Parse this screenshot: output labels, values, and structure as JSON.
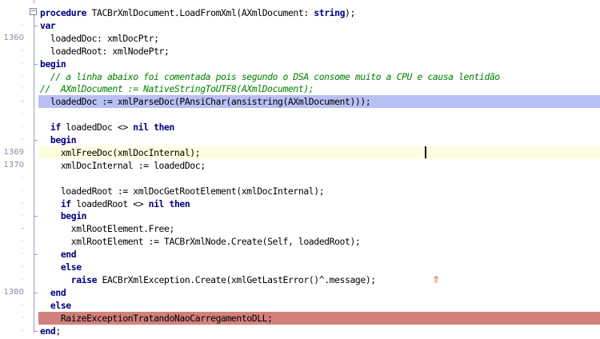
{
  "editor": {
    "lines": [
      {
        "num": "",
        "tokens": [
          {
            "t": "procedure",
            "c": "kw"
          },
          {
            "t": " TACBrXmlDocument.LoadFromXml(AXmlDocument: "
          },
          {
            "t": "string",
            "c": "kw"
          },
          {
            "t": ");"
          }
        ]
      },
      {
        "num": "·",
        "tokens": [
          {
            "t": "var",
            "c": "kw"
          }
        ]
      },
      {
        "num": "1360",
        "tokens": [
          {
            "t": "  loadedDoc: xmlDocPtr;"
          }
        ]
      },
      {
        "num": "·",
        "tokens": [
          {
            "t": "  loadedRoot: xmlNodePtr;"
          }
        ]
      },
      {
        "num": "·",
        "tokens": [
          {
            "t": "begin",
            "c": "kw"
          }
        ]
      },
      {
        "num": "·",
        "tokens": [
          {
            "t": "  // a linha abaixo foi comentada pois segundo o DSA consome muito a CPU e causa lentidão",
            "c": "cm"
          }
        ]
      },
      {
        "num": "·",
        "tokens": [
          {
            "t": "//  AXmlDocument := NativeStringToUTF8(AXmlDocument);",
            "c": "cm"
          }
        ]
      },
      {
        "num": "–",
        "tokens": [
          {
            "t": "  loadedDoc := xmlParseDoc(PAnsiChar(ansistring(AXmlDocument)));"
          }
        ],
        "highlight": "active"
      },
      {
        "num": "·",
        "tokens": [
          {
            "t": ""
          }
        ]
      },
      {
        "num": "·",
        "tokens": [
          {
            "t": "  "
          },
          {
            "t": "if",
            "c": "kw"
          },
          {
            "t": " loadedDoc <> "
          },
          {
            "t": "nil",
            "c": "kw"
          },
          {
            "t": " "
          },
          {
            "t": "then",
            "c": "kw"
          }
        ]
      },
      {
        "num": "·",
        "tokens": [
          {
            "t": "  "
          },
          {
            "t": "begin",
            "c": "kw"
          }
        ]
      },
      {
        "num": "1369",
        "tokens": [
          {
            "t": "    xmlFreeDoc(xmlDocInternal);"
          }
        ],
        "highlight": "cursor"
      },
      {
        "num": "1370",
        "tokens": [
          {
            "t": "    xmlDocInternal := loadedDoc;"
          }
        ]
      },
      {
        "num": "·",
        "tokens": [
          {
            "t": ""
          }
        ]
      },
      {
        "num": "·",
        "tokens": [
          {
            "t": "    loadedRoot := xmlDocGetRootElement(xmlDocInternal);"
          }
        ]
      },
      {
        "num": "·",
        "tokens": [
          {
            "t": "    "
          },
          {
            "t": "if",
            "c": "kw"
          },
          {
            "t": " loadedRoot <> "
          },
          {
            "t": "nil",
            "c": "kw"
          },
          {
            "t": " "
          },
          {
            "t": "then",
            "c": "kw"
          }
        ]
      },
      {
        "num": "·",
        "tokens": [
          {
            "t": "    "
          },
          {
            "t": "begin",
            "c": "kw"
          }
        ]
      },
      {
        "num": "–",
        "tokens": [
          {
            "t": "      xmlRootElement.Free;"
          }
        ]
      },
      {
        "num": "·",
        "tokens": [
          {
            "t": "      xmlRootElement := TACBrXmlNode.Create(Self, loadedRoot);"
          }
        ]
      },
      {
        "num": "·",
        "tokens": [
          {
            "t": "    "
          },
          {
            "t": "end",
            "c": "kw"
          }
        ]
      },
      {
        "num": "·",
        "tokens": [
          {
            "t": "    "
          },
          {
            "t": "else",
            "c": "kw"
          }
        ]
      },
      {
        "num": "·",
        "tokens": [
          {
            "t": "      "
          },
          {
            "t": "raise",
            "c": "kw"
          },
          {
            "t": " EACBrXmlException.Create(xmlGetLastError()^.message);"
          }
        ]
      },
      {
        "num": "1380",
        "tokens": [
          {
            "t": "  "
          },
          {
            "t": "end",
            "c": "kw"
          }
        ]
      },
      {
        "num": "·",
        "tokens": [
          {
            "t": "  "
          },
          {
            "t": "else",
            "c": "kw"
          }
        ]
      },
      {
        "num": "·",
        "tokens": [
          {
            "t": "    RaizeExceptionTratandoNaoCarregamentoDLL;"
          }
        ],
        "highlight": "error"
      },
      {
        "num": "·",
        "tokens": [
          {
            "t": "end",
            "c": "kw"
          },
          {
            "t": ";"
          }
        ]
      }
    ]
  },
  "icons": {
    "fold": "minus-box-icon",
    "jump": "jump-arrow-icon"
  },
  "colors": {
    "keyword": "#000080",
    "comment": "#008000",
    "active_line": "#b8c0f4",
    "error_line": "#d2807c",
    "cursor_line": "#fdfde0",
    "gutter_text": "#8a8aa8"
  }
}
